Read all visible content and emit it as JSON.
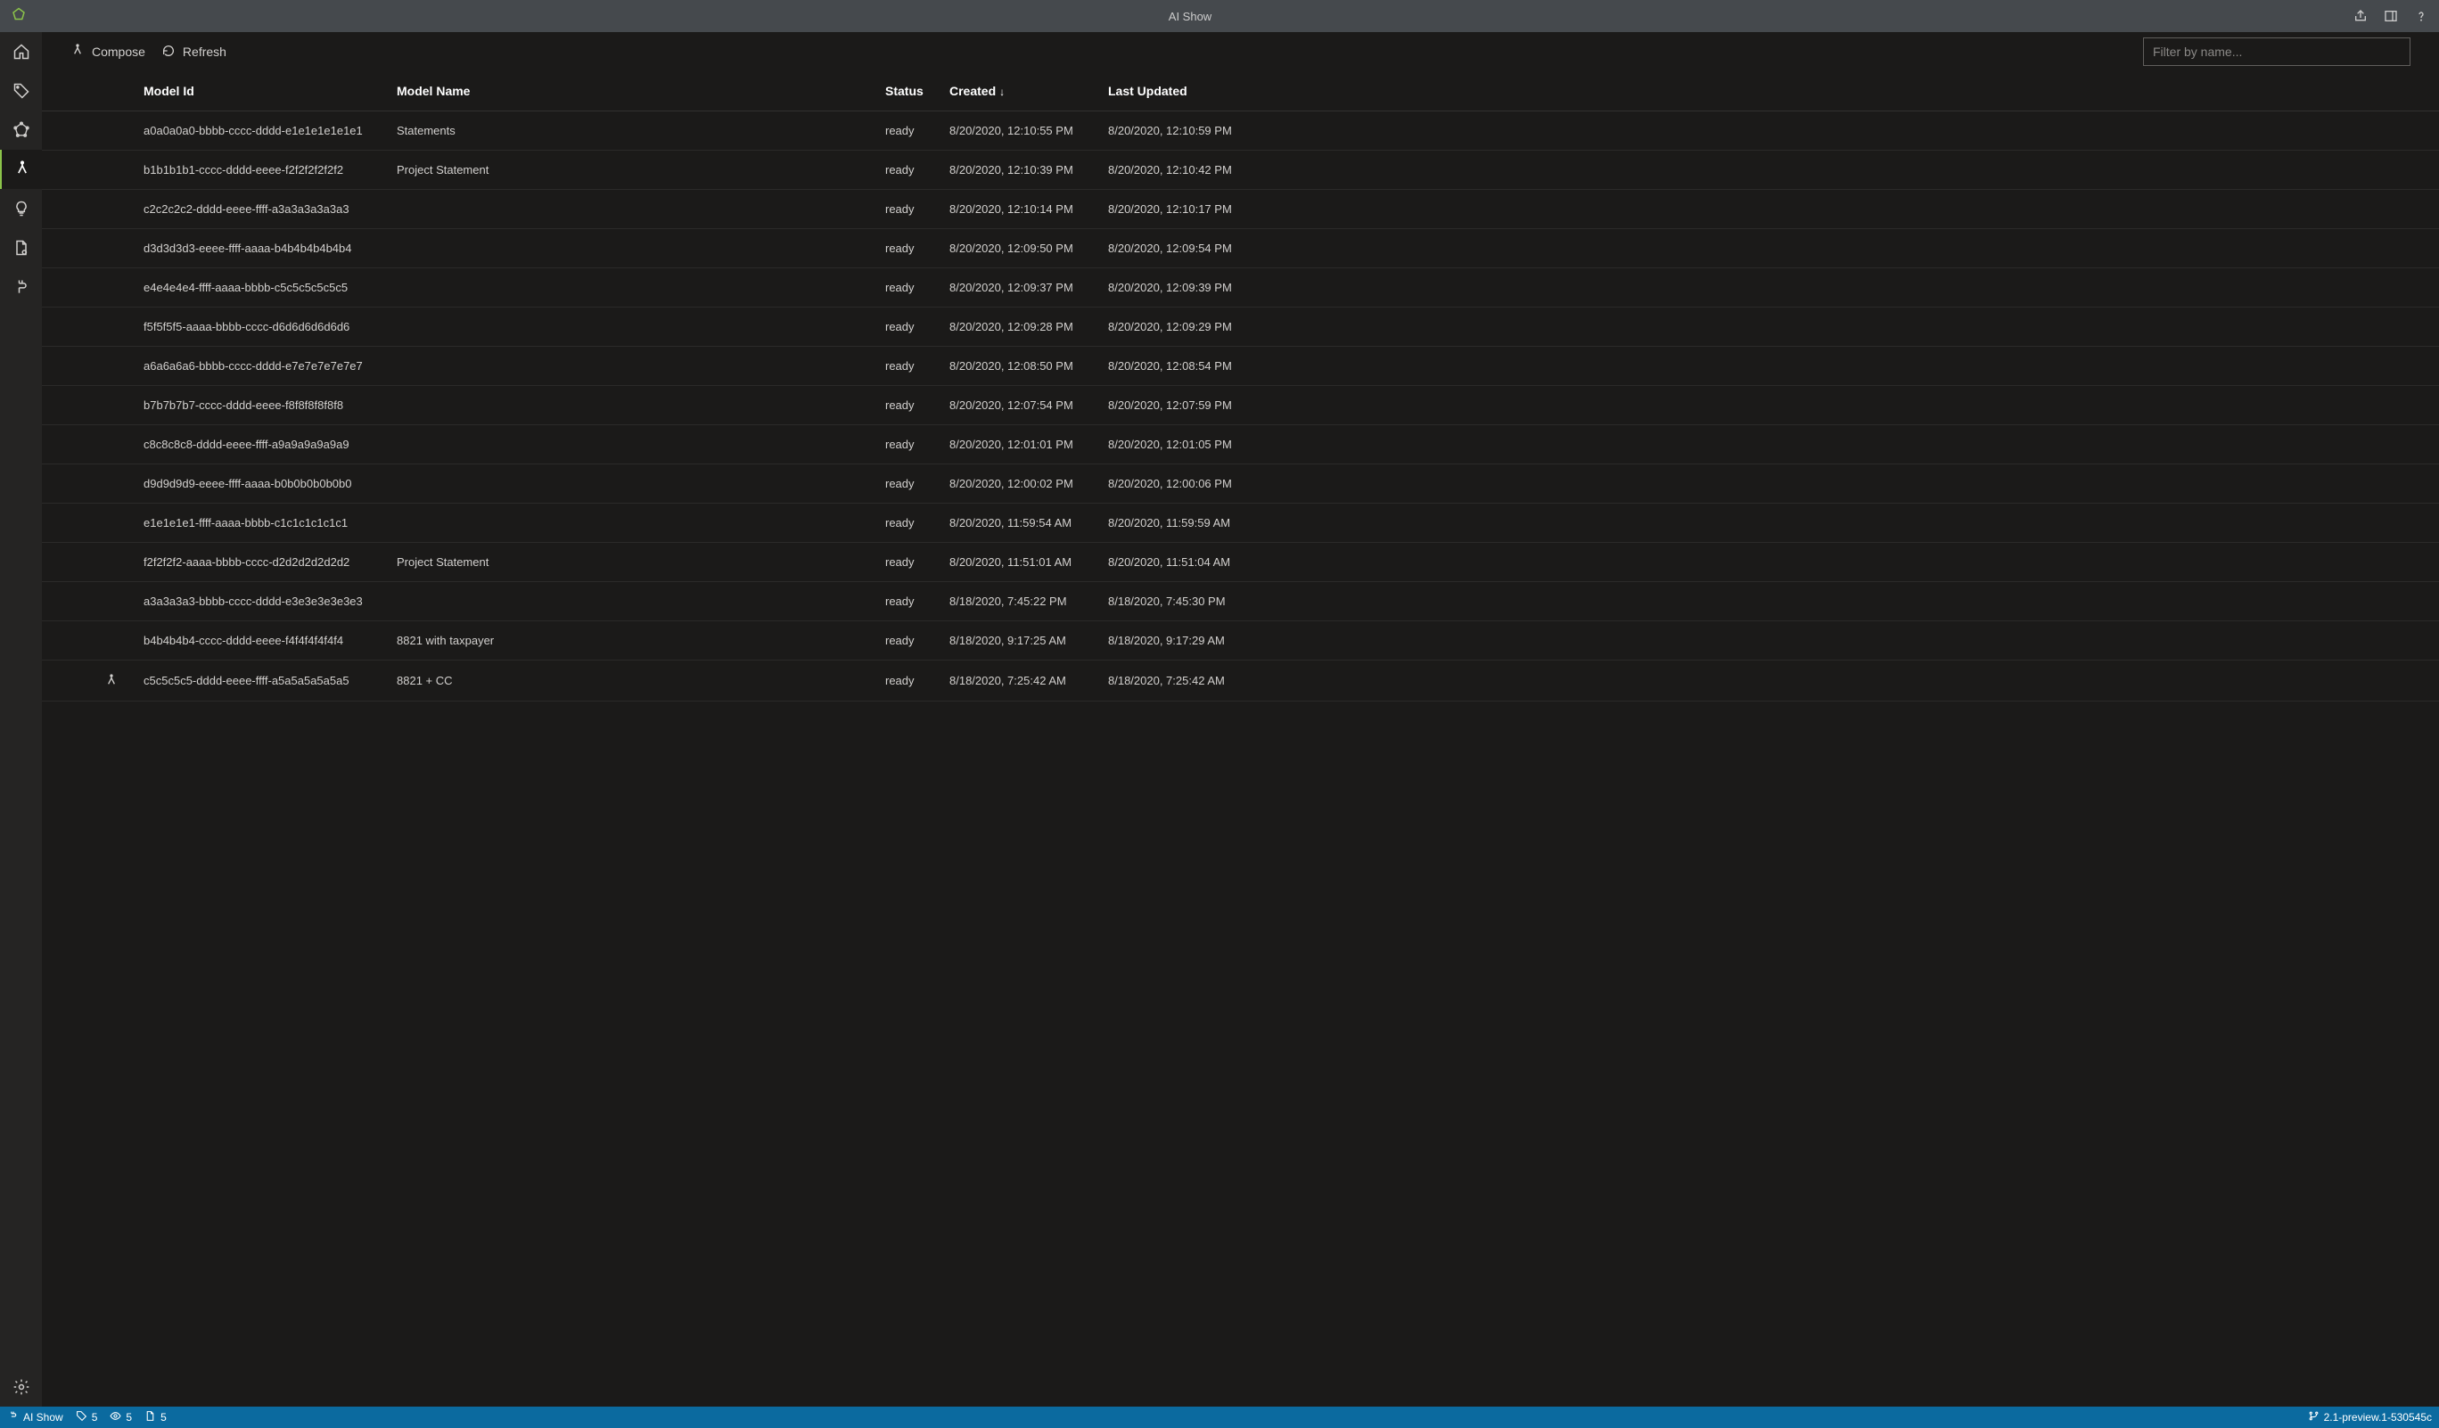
{
  "titlebar": {
    "title": "AI Show"
  },
  "toolbar": {
    "compose_label": "Compose",
    "refresh_label": "Refresh",
    "filter_placeholder": "Filter by name..."
  },
  "columns": {
    "model_id": "Model Id",
    "model_name": "Model Name",
    "status": "Status",
    "created": "Created",
    "last_updated": "Last Updated",
    "sort_indicator": "↓"
  },
  "rows": [
    {
      "id": "a0a0a0a0-bbbb-cccc-dddd-e1e1e1e1e1e1",
      "name": "Statements",
      "status": "ready",
      "created": "8/20/2020, 12:10:55 PM",
      "updated": "8/20/2020, 12:10:59 PM",
      "icon": false
    },
    {
      "id": "b1b1b1b1-cccc-dddd-eeee-f2f2f2f2f2f2",
      "name": "Project Statement",
      "status": "ready",
      "created": "8/20/2020, 12:10:39 PM",
      "updated": "8/20/2020, 12:10:42 PM",
      "icon": false
    },
    {
      "id": "c2c2c2c2-dddd-eeee-ffff-a3a3a3a3a3a3",
      "name": "",
      "status": "ready",
      "created": "8/20/2020, 12:10:14 PM",
      "updated": "8/20/2020, 12:10:17 PM",
      "icon": false
    },
    {
      "id": "d3d3d3d3-eeee-ffff-aaaa-b4b4b4b4b4b4",
      "name": "",
      "status": "ready",
      "created": "8/20/2020, 12:09:50 PM",
      "updated": "8/20/2020, 12:09:54 PM",
      "icon": false
    },
    {
      "id": "e4e4e4e4-ffff-aaaa-bbbb-c5c5c5c5c5c5",
      "name": "",
      "status": "ready",
      "created": "8/20/2020, 12:09:37 PM",
      "updated": "8/20/2020, 12:09:39 PM",
      "icon": false
    },
    {
      "id": "f5f5f5f5-aaaa-bbbb-cccc-d6d6d6d6d6d6",
      "name": "",
      "status": "ready",
      "created": "8/20/2020, 12:09:28 PM",
      "updated": "8/20/2020, 12:09:29 PM",
      "icon": false
    },
    {
      "id": "a6a6a6a6-bbbb-cccc-dddd-e7e7e7e7e7e7",
      "name": "",
      "status": "ready",
      "created": "8/20/2020, 12:08:50 PM",
      "updated": "8/20/2020, 12:08:54 PM",
      "icon": false
    },
    {
      "id": "b7b7b7b7-cccc-dddd-eeee-f8f8f8f8f8f8",
      "name": "",
      "status": "ready",
      "created": "8/20/2020, 12:07:54 PM",
      "updated": "8/20/2020, 12:07:59 PM",
      "icon": false
    },
    {
      "id": "c8c8c8c8-dddd-eeee-ffff-a9a9a9a9a9a9",
      "name": "",
      "status": "ready",
      "created": "8/20/2020, 12:01:01 PM",
      "updated": "8/20/2020, 12:01:05 PM",
      "icon": false
    },
    {
      "id": "d9d9d9d9-eeee-ffff-aaaa-b0b0b0b0b0b0",
      "name": "",
      "status": "ready",
      "created": "8/20/2020, 12:00:02 PM",
      "updated": "8/20/2020, 12:00:06 PM",
      "icon": false
    },
    {
      "id": "e1e1e1e1-ffff-aaaa-bbbb-c1c1c1c1c1c1",
      "name": "",
      "status": "ready",
      "created": "8/20/2020, 11:59:54 AM",
      "updated": "8/20/2020, 11:59:59 AM",
      "icon": false
    },
    {
      "id": "f2f2f2f2-aaaa-bbbb-cccc-d2d2d2d2d2d2",
      "name": "Project Statement",
      "status": "ready",
      "created": "8/20/2020, 11:51:01 AM",
      "updated": "8/20/2020, 11:51:04 AM",
      "icon": false
    },
    {
      "id": "a3a3a3a3-bbbb-cccc-dddd-e3e3e3e3e3e3",
      "name": "",
      "status": "ready",
      "created": "8/18/2020, 7:45:22 PM",
      "updated": "8/18/2020, 7:45:30 PM",
      "icon": false
    },
    {
      "id": "b4b4b4b4-cccc-dddd-eeee-f4f4f4f4f4f4",
      "name": "8821 with taxpayer",
      "status": "ready",
      "created": "8/18/2020, 9:17:25 AM",
      "updated": "8/18/2020, 9:17:29 AM",
      "icon": false
    },
    {
      "id": "c5c5c5c5-dddd-eeee-ffff-a5a5a5a5a5a5",
      "name": "8821 + CC",
      "status": "ready",
      "created": "8/18/2020, 7:25:42 AM",
      "updated": "8/18/2020, 7:25:42 AM",
      "icon": true
    }
  ],
  "statusbar": {
    "project_name": "AI Show",
    "tags_count": "5",
    "connections_count": "5",
    "docs_count": "5",
    "version": "2.1-preview.1-530545c"
  }
}
